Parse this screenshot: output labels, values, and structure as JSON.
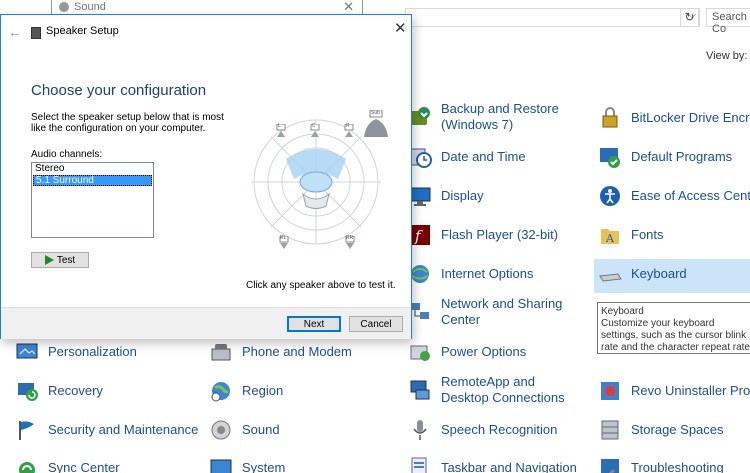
{
  "control_panel": {
    "search_placeholder": "Search Co",
    "view_by": "View by:",
    "items": [
      {
        "label": "Backup and Restore (Windows 7)",
        "icon": "backup-icon"
      },
      {
        "label": "BitLocker Drive Encryp",
        "icon": "bitlocker-icon"
      },
      {
        "label": "Date and Time",
        "icon": "clock-icon"
      },
      {
        "label": "Default Programs",
        "icon": "default-programs-icon"
      },
      {
        "label": "Display",
        "icon": "display-icon"
      },
      {
        "label": "Ease of Access Center",
        "icon": "accessibility-icon"
      },
      {
        "label": "Flash Player (32-bit)",
        "icon": "flash-icon"
      },
      {
        "label": "Fonts",
        "icon": "fonts-icon"
      },
      {
        "label": "Internet Options",
        "icon": "globe-icon"
      },
      {
        "label": "Keyboard",
        "icon": "keyboard-icon"
      },
      {
        "label": "Network and Sharing Center",
        "icon": "network-icon"
      },
      {
        "label": "Personalization",
        "icon": "personalization-icon"
      },
      {
        "label": "Phone and Modem",
        "icon": "phone-icon"
      },
      {
        "label": "Power Options",
        "icon": "power-icon"
      },
      {
        "label": "Recovery",
        "icon": "recovery-icon"
      },
      {
        "label": "Region",
        "icon": "region-icon"
      },
      {
        "label": "RemoteApp and Desktop Connections",
        "icon": "remote-icon"
      },
      {
        "label": "Revo Uninstaller Pro",
        "icon": "revo-icon"
      },
      {
        "label": "Security and Maintenance",
        "icon": "flag-icon"
      },
      {
        "label": "Sound",
        "icon": "speaker-icon"
      },
      {
        "label": "Speech Recognition",
        "icon": "microphone-icon"
      },
      {
        "label": "Storage Spaces",
        "icon": "storage-icon"
      },
      {
        "label": "Sync Center",
        "icon": "sync-icon"
      },
      {
        "label": "System",
        "icon": "system-icon"
      },
      {
        "label": "Taskbar and Navigation",
        "icon": "taskbar-icon"
      },
      {
        "label": "Troubleshooting",
        "icon": "troubleshooting-icon"
      }
    ],
    "tooltip": {
      "title": "Keyboard",
      "text": "Customize your keyboard settings, such as the cursor blink rate and the character repeat rate."
    }
  },
  "sound_window": {
    "title": "Sound"
  },
  "dialog": {
    "title": "Speaker Setup",
    "heading": "Choose your configuration",
    "description": "Select the speaker setup below that is most like the configuration on your computer.",
    "channels_label": "Audio channels:",
    "channels": [
      "Stereo",
      "5.1 Surround"
    ],
    "selected_channel": "5.1 Surround",
    "test_label": "Test",
    "hint": "Click any speaker above to test it.",
    "next_label": "Next",
    "cancel_label": "Cancel",
    "speakers": {
      "left": "L",
      "center": "C",
      "right": "R",
      "sub": "Sub",
      "rear_left": "RL",
      "rear_right": "RR"
    }
  },
  "colors": {
    "link": "#1e4f8c",
    "heading": "#1f3f75",
    "selection": "#3399ff",
    "accent": "#0078d7"
  }
}
